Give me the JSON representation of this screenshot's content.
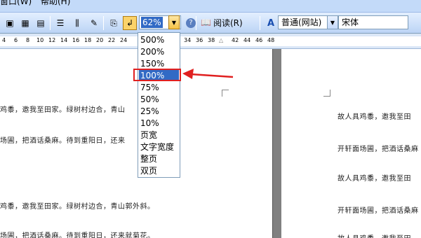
{
  "menubar": {
    "items": [
      "窗口(W)",
      "帮助(H)"
    ]
  },
  "toolbar": {
    "zoom_value": "62%",
    "help_icon": "?",
    "read_label": "阅读(R)",
    "style_value": "普通(网站)",
    "font_value": "宋体"
  },
  "ruler": {
    "left_ticks": [
      "4",
      "6",
      "8",
      "10",
      "12",
      "14",
      "16",
      "18",
      "20",
      "22",
      "24"
    ],
    "right_ticks": [
      "34",
      "36",
      "38",
      "42",
      "44",
      "46",
      "48"
    ]
  },
  "zoom_menu": {
    "options": [
      "500%",
      "200%",
      "150%",
      "100%",
      "75%",
      "50%",
      "25%",
      "10%",
      "页宽",
      "文字宽度",
      "整页",
      "双页"
    ],
    "selected": "100%"
  },
  "document": {
    "left_lines": [
      "鸡黍，邀我至田家。绿树村边合，青山",
      "场圃，把酒话桑麻。待到重阳日，还来",
      "鸡黍，邀我至田家。绿树村边合，青山郭外斜。",
      "场圃，把酒话桑麻。待到重阳日，还来就菊花。"
    ],
    "right_lines": [
      "故人具鸡黍，邀我至田",
      "开轩面场圃，把酒话桑麻",
      "故人具鸡黍，邀我至田",
      "开轩面场圃，把酒话桑麻",
      "故人具鸡黍，邀我至田"
    ]
  },
  "colors": {
    "highlight": "#316ac5",
    "annotation": "#e02020"
  }
}
